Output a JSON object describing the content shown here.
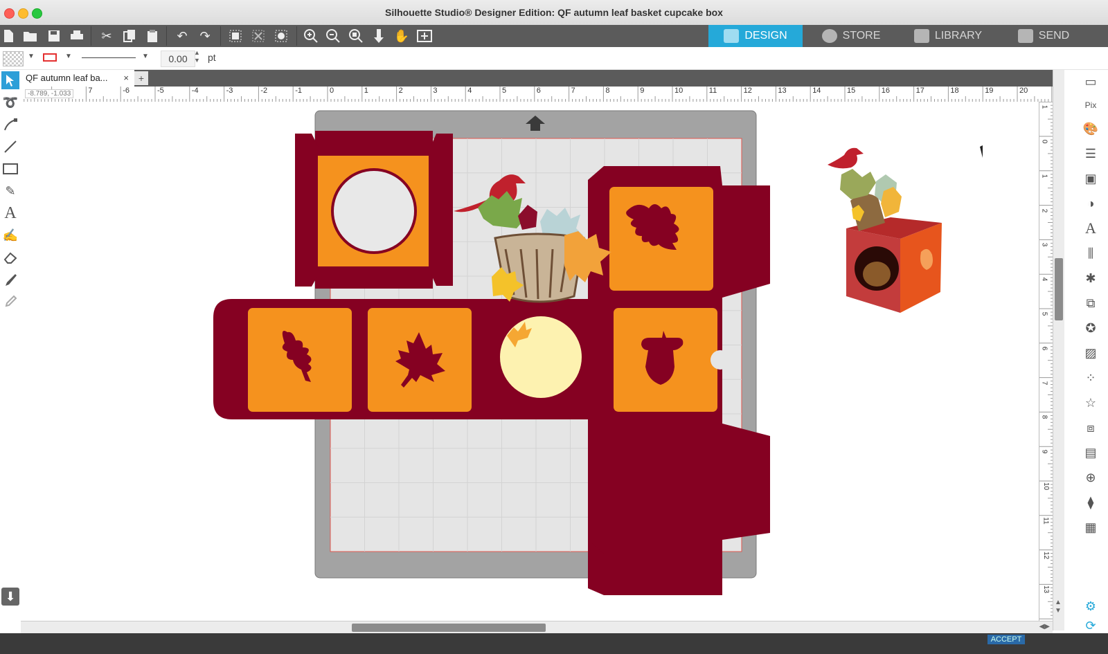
{
  "window": {
    "title": "Silhouette Studio® Designer Edition: QF autumn leaf basket cupcake box"
  },
  "nav_tabs": [
    {
      "label": "DESIGN",
      "active": true
    },
    {
      "label": "STORE",
      "active": false
    },
    {
      "label": "LIBRARY",
      "active": false
    },
    {
      "label": "SEND",
      "active": false
    }
  ],
  "toolbar": {
    "icons": [
      "new-document-icon",
      "open-folder-icon",
      "save-icon",
      "print-icon",
      "cut-icon",
      "copy-icon",
      "paste-icon",
      "undo-icon",
      "redo-icon",
      "group-icon",
      "ungroup-icon",
      "compound-path-icon",
      "zoom-in-icon",
      "zoom-out-icon",
      "zoom-fit-icon",
      "move-down-icon",
      "pan-hand-icon",
      "fit-page-icon"
    ]
  },
  "properties": {
    "line_width_value": "0.00",
    "line_width_unit": "pt"
  },
  "document_tab": {
    "label": "QF autumn leaf ba...",
    "close": "×",
    "add": "+"
  },
  "ruler": {
    "coords": "-8.789, -1.033",
    "h_labels": [
      "7",
      "-6",
      "-5",
      "-4",
      "-3",
      "-2",
      "-1",
      "0",
      "1",
      "2",
      "3",
      "4",
      "5",
      "6",
      "7",
      "8",
      "9",
      "10",
      "11",
      "12",
      "13",
      "14",
      "15",
      "16",
      "17",
      "18",
      "19",
      "20"
    ],
    "v_labels": [
      "1",
      "0",
      "1",
      "2",
      "3",
      "4",
      "5",
      "6",
      "7",
      "8",
      "9",
      "10",
      "11",
      "12",
      "13"
    ]
  },
  "status": {
    "accept_label": "ACCEPT"
  },
  "colors": {
    "burgundy": "#850122",
    "orange": "#f5921e",
    "mat_gray": "#a3a3a3",
    "cutting_area": "#e5e5e5",
    "design_tab": "#25a9d9",
    "toolbar": "#5b5b5b"
  }
}
